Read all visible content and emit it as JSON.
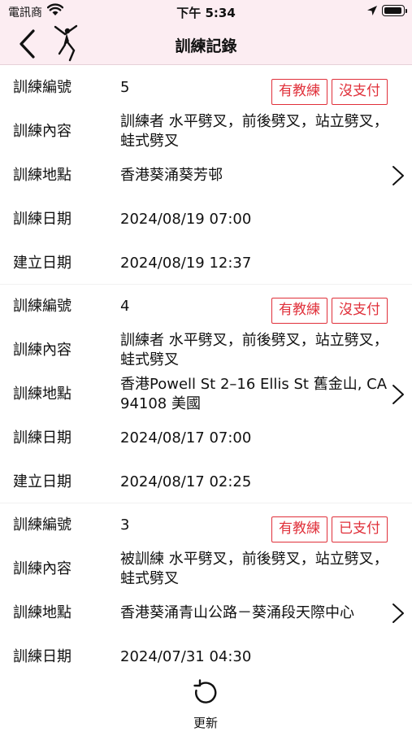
{
  "status_bar": {
    "carrier": "電訊商",
    "time": "下午 5:34"
  },
  "nav": {
    "title": "訓練記錄"
  },
  "labels": {
    "id": "訓練編號",
    "content": "訓練內容",
    "location": "訓練地點",
    "train_date": "訓練日期",
    "created_date": "建立日期"
  },
  "records": [
    {
      "id": "5",
      "coach_badge": "有教練",
      "pay_badge": "沒支付",
      "content": "訓練者 水平劈叉，前後劈叉，站立劈叉，蛙式劈叉",
      "location": "香港葵涌葵芳邨",
      "train_date": "2024/08/19 07:00",
      "created_date": "2024/08/19 12:37"
    },
    {
      "id": "4",
      "coach_badge": "有教練",
      "pay_badge": "沒支付",
      "content": "訓練者 水平劈叉，前後劈叉，站立劈叉，蛙式劈叉",
      "location": "香港Powell St 2–16 Ellis St 舊金山, CA  94108 美國",
      "train_date": "2024/08/17 07:00",
      "created_date": "2024/08/17 02:25"
    },
    {
      "id": "3",
      "coach_badge": "有教練",
      "pay_badge": "已支付",
      "content": "被訓練 水平劈叉，前後劈叉，站立劈叉，蛙式劈叉",
      "location": "香港葵涌青山公路－葵涌段天際中心",
      "train_date": "2024/07/31 04:30"
    }
  ],
  "bottom": {
    "refresh_label": "更新"
  },
  "colors": {
    "nav_background": "#fcedf2",
    "badge_red": "#e0303a"
  },
  "icons": {
    "back": "chevron-left-icon",
    "logo": "dancer-logo-icon",
    "row_chevron": "chevron-right-icon",
    "refresh": "refresh-icon"
  }
}
